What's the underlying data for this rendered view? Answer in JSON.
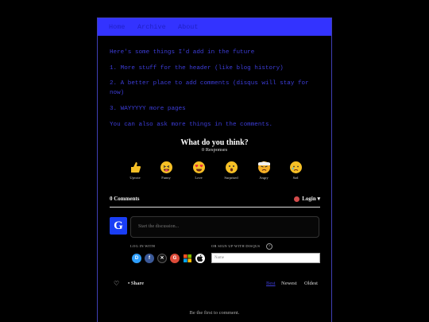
{
  "nav": {
    "items": [
      "Home",
      "Archive",
      "About"
    ]
  },
  "post": {
    "lines": [
      "Here's some things I'd add in the future",
      "1. More stuff for the header (like blog history)",
      "2. A better place to add comments (disqus will stay for now)",
      "3. WAYYYYY more pages",
      "You can also ask more things in the comments."
    ]
  },
  "reactions": {
    "title": "What do you think?",
    "responses": "0 Responses",
    "items": [
      {
        "label": "Upvote",
        "icon": "thumbs-up-icon"
      },
      {
        "label": "Funny",
        "icon": "tongue-face-icon"
      },
      {
        "label": "Love",
        "icon": "heart-eyes-icon"
      },
      {
        "label": "Surprised",
        "icon": "surprised-face-icon"
      },
      {
        "label": "Angry",
        "icon": "angry-face-icon"
      },
      {
        "label": "Sad",
        "icon": "sad-face-icon"
      }
    ]
  },
  "comments": {
    "count_label": "0 Comments",
    "login_label": "Login ▾",
    "avatar_letter": "G",
    "discussion_placeholder": "Start the discussion...",
    "log_in_with": "LOG IN WITH",
    "or_sign_up": "OR SIGN UP WITH DISQUS",
    "question_mark": "?",
    "social": [
      {
        "letter": "D",
        "icon": "disqus-icon",
        "color": "#2e9fff"
      },
      {
        "letter": "f",
        "icon": "facebook-icon",
        "color": "#3b5998"
      },
      {
        "letter": "✕",
        "icon": "x-icon",
        "color": "#111111"
      },
      {
        "letter": "G",
        "icon": "google-icon",
        "color": "#dd4b39"
      },
      {
        "letter": "■",
        "icon": "microsoft-icon",
        "color": "#7fba00"
      },
      {
        "letter": "",
        "icon": "apple-icon",
        "color": "#ffffff"
      }
    ],
    "name_placeholder": "Name",
    "share_label": "• Share",
    "sort": [
      "Best",
      "Newest",
      "Oldest"
    ],
    "empty_label": "Be the first to comment."
  },
  "colors": {
    "accent": "#3333ff",
    "text_accent": "#3d3dd8"
  }
}
